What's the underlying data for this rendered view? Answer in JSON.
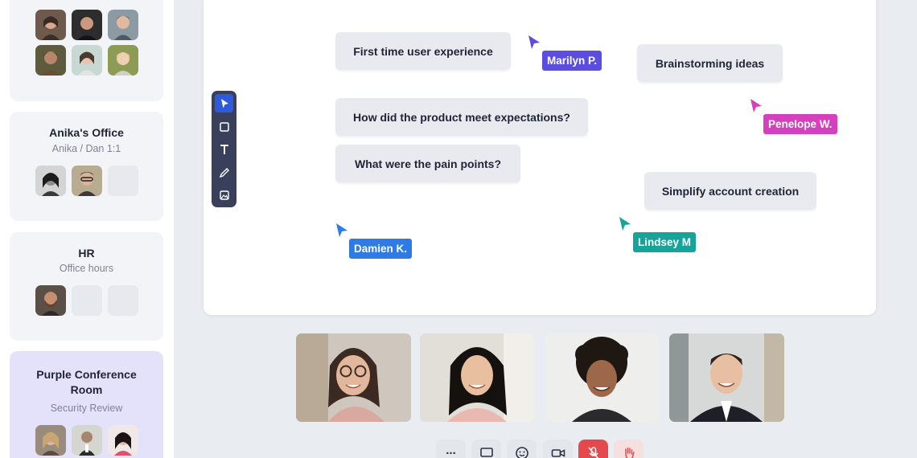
{
  "colors": {
    "accent_blue": "#2f5bd8",
    "active_room": "#e4e1fb",
    "mute_red": "#e5484d",
    "marilyn": "#5b4de0",
    "penelope": "#d63fbd",
    "damien": "#2e7be6",
    "lindsey": "#15a39a"
  },
  "sidebar": {
    "rooms": [
      {
        "title": "",
        "subtitle": "",
        "avatar_count": 6
      },
      {
        "title": "Anika's Office",
        "subtitle": "Anika / Dan 1:1",
        "avatar_count": 2,
        "empty_slots": 1
      },
      {
        "title": "HR",
        "subtitle": "Office hours",
        "avatar_count": 1,
        "empty_slots": 2
      },
      {
        "title": "Purple Conference Room",
        "subtitle": "Security Review",
        "avatar_count": 3,
        "active": true
      }
    ]
  },
  "board": {
    "notes": [
      "First time user experience",
      "Brainstorming ideas",
      "How did the product meet expectations?",
      "What were the pain points?",
      "Simplify account creation"
    ],
    "tools": [
      "pointer-icon",
      "rectangle-icon",
      "text-icon",
      "pen-icon",
      "image-icon"
    ],
    "cursors": [
      {
        "name": "Marilyn P.",
        "color": "#5b4de0"
      },
      {
        "name": "Penelope W.",
        "color": "#d63fbd"
      },
      {
        "name": "Damien K.",
        "color": "#2e7be6"
      },
      {
        "name": "Lindsey M",
        "color": "#15a39a"
      }
    ]
  },
  "participants": {
    "tiles": [
      "video-tile-1",
      "video-tile-2",
      "video-tile-3",
      "video-tile-4"
    ]
  },
  "controls": {
    "more_label": "...",
    "buttons": [
      "more-icon",
      "screen-share-icon",
      "emoji-icon",
      "camera-icon",
      "mic-muted-icon",
      "raise-hand-icon"
    ]
  }
}
